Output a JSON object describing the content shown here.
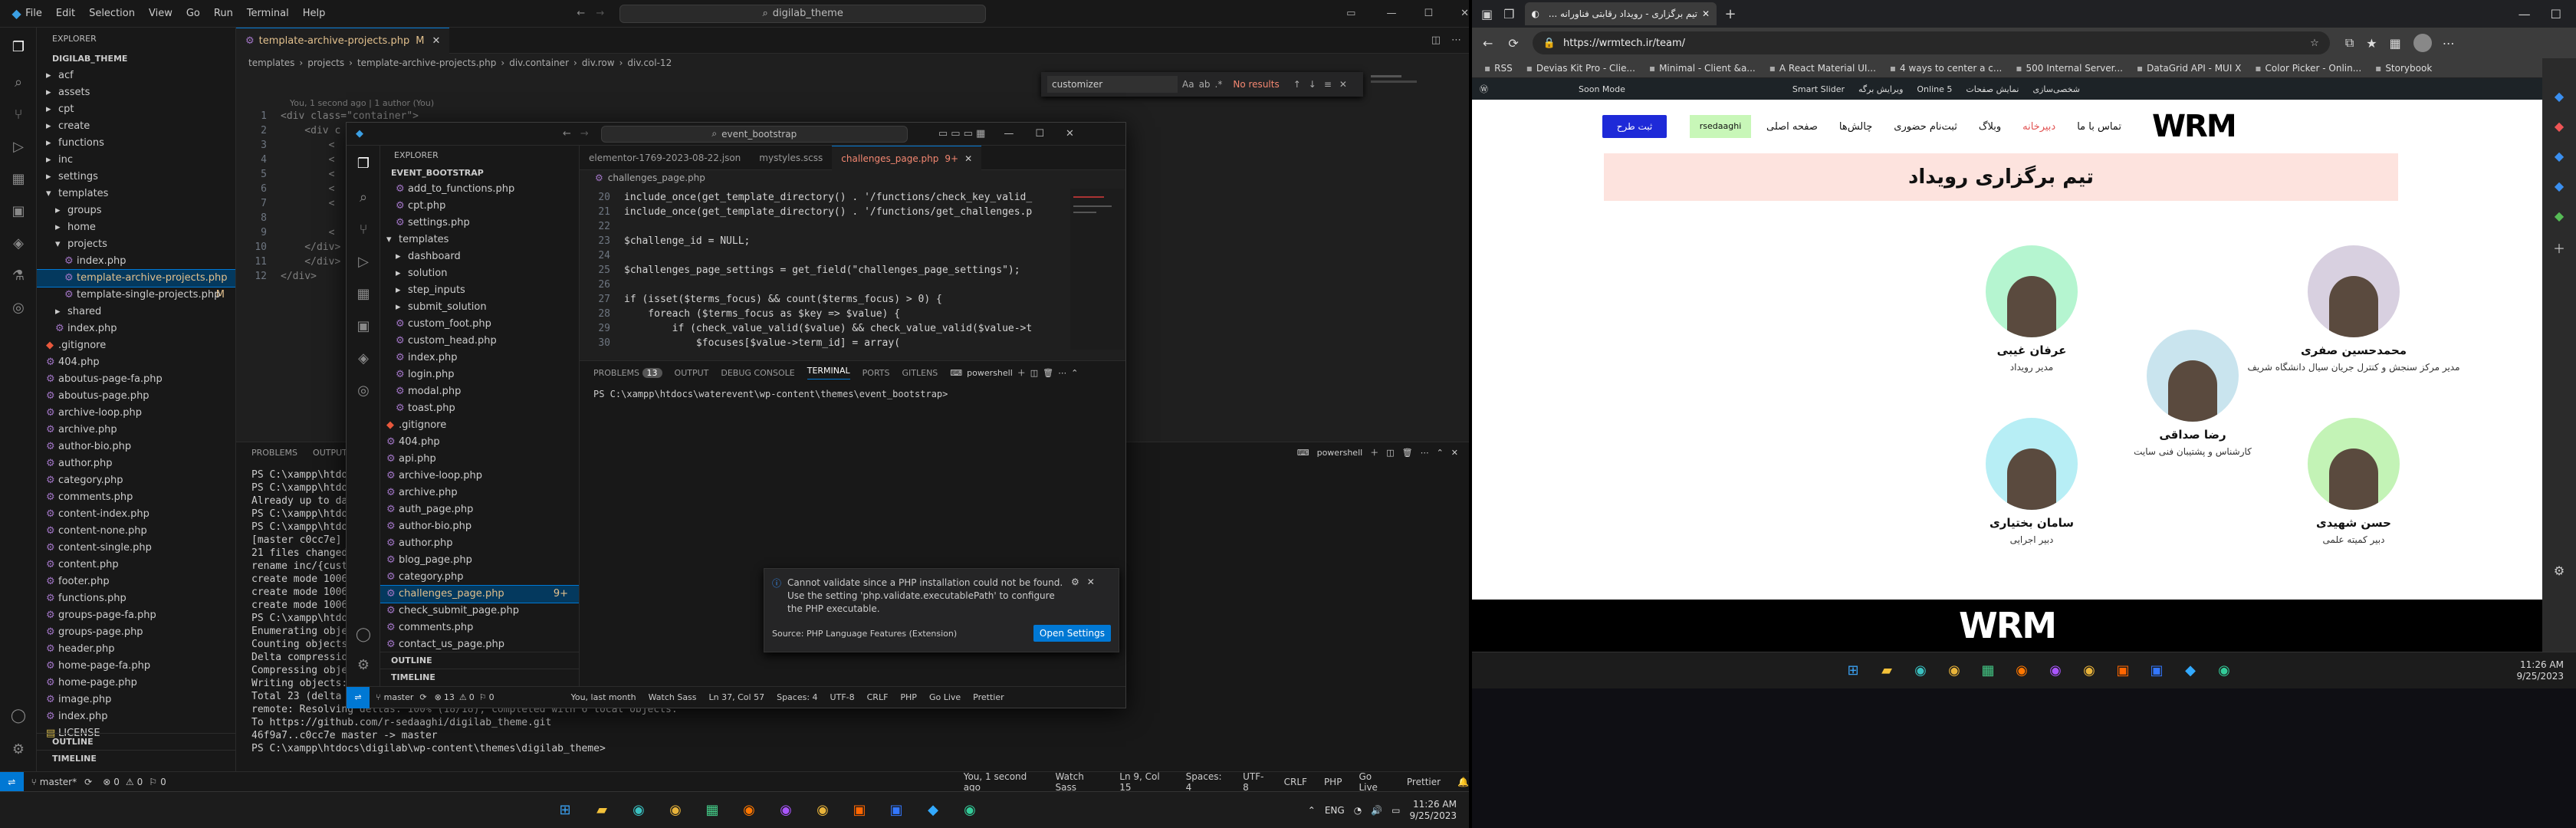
{
  "outer_vscode": {
    "menu": [
      "File",
      "Edit",
      "Selection",
      "View",
      "Go",
      "Run",
      "Terminal",
      "Help"
    ],
    "search": "digilab_theme",
    "explorer_title": "EXPLORER",
    "root": "DIGILAB_THEME",
    "tree": [
      {
        "t": "acf",
        "k": "f",
        "d": 1
      },
      {
        "t": "assets",
        "k": "f",
        "d": 1
      },
      {
        "t": "cpt",
        "k": "f",
        "d": 1
      },
      {
        "t": "create",
        "k": "f",
        "d": 1
      },
      {
        "t": "functions",
        "k": "f",
        "d": 1
      },
      {
        "t": "inc",
        "k": "f",
        "d": 1
      },
      {
        "t": "settings",
        "k": "f",
        "d": 1
      },
      {
        "t": "templates",
        "k": "fo",
        "d": 1
      },
      {
        "t": "groups",
        "k": "f",
        "d": 2
      },
      {
        "t": "home",
        "k": "f",
        "d": 2
      },
      {
        "t": "projects",
        "k": "fo",
        "d": 2
      },
      {
        "t": "index.php",
        "k": "p",
        "d": 3
      },
      {
        "t": "template-archive-projects.php",
        "k": "p",
        "d": 3,
        "sel": true,
        "m": "M"
      },
      {
        "t": "template-single-projects.php",
        "k": "p",
        "d": 3
      },
      {
        "t": "shared",
        "k": "f",
        "d": 2
      },
      {
        "t": "index.php",
        "k": "p",
        "d": 2
      },
      {
        "t": ".gitignore",
        "k": "g",
        "d": 1
      },
      {
        "t": "404.php",
        "k": "p",
        "d": 1
      },
      {
        "t": "aboutus-page-fa.php",
        "k": "p",
        "d": 1
      },
      {
        "t": "aboutus-page.php",
        "k": "p",
        "d": 1
      },
      {
        "t": "archive-loop.php",
        "k": "p",
        "d": 1
      },
      {
        "t": "archive.php",
        "k": "p",
        "d": 1
      },
      {
        "t": "author-bio.php",
        "k": "p",
        "d": 1
      },
      {
        "t": "author.php",
        "k": "p",
        "d": 1
      },
      {
        "t": "category.php",
        "k": "p",
        "d": 1
      },
      {
        "t": "comments.php",
        "k": "p",
        "d": 1
      },
      {
        "t": "content-index.php",
        "k": "p",
        "d": 1
      },
      {
        "t": "content-none.php",
        "k": "p",
        "d": 1
      },
      {
        "t": "content-single.php",
        "k": "p",
        "d": 1
      },
      {
        "t": "content.php",
        "k": "p",
        "d": 1
      },
      {
        "t": "footer.php",
        "k": "p",
        "d": 1
      },
      {
        "t": "functions.php",
        "k": "p",
        "d": 1
      },
      {
        "t": "groups-page-fa.php",
        "k": "p",
        "d": 1
      },
      {
        "t": "groups-page.php",
        "k": "p",
        "d": 1
      },
      {
        "t": "header.php",
        "k": "p",
        "d": 1
      },
      {
        "t": "home-page-fa.php",
        "k": "p",
        "d": 1
      },
      {
        "t": "home-page.php",
        "k": "p",
        "d": 1
      },
      {
        "t": "image.php",
        "k": "p",
        "d": 1
      },
      {
        "t": "index.php",
        "k": "p",
        "d": 1
      },
      {
        "t": "LICENSE",
        "k": "l",
        "d": 1
      }
    ],
    "outline": "OUTLINE",
    "timeline": "TIMELINE",
    "tab": "template-archive-projects.php",
    "tab_mod": "M",
    "breadcrumb": [
      "templates",
      "projects",
      "template-archive-projects.php",
      "div.container",
      "div.row",
      "div.col-12"
    ],
    "blame": "You, 1 second ago | 1 author (You)",
    "code": [
      {
        "n": "1",
        "t": "<div class=\"container\">"
      },
      {
        "n": "2",
        "t": "    <div c"
      },
      {
        "n": "3",
        "t": "        <"
      },
      {
        "n": "4",
        "t": "        <"
      },
      {
        "n": "5",
        "t": "        <"
      },
      {
        "n": "6",
        "t": "        <"
      },
      {
        "n": "7",
        "t": "        <"
      },
      {
        "n": "8",
        "t": ""
      },
      {
        "n": "9",
        "t": "        <"
      },
      {
        "n": "10",
        "t": "    </div>"
      },
      {
        "n": "11",
        "t": "    </div>"
      },
      {
        "n": "12",
        "t": "</div>"
      }
    ],
    "find": {
      "value": "customizer",
      "result": "No results"
    },
    "panel_tabs": [
      "PROBLEMS",
      "OUTPUT"
    ],
    "terminal_name": "powershell",
    "terminal": [
      "PS C:\\xampp\\htdoc",
      "PS C:\\xampp\\htdoc",
      "Already up to dat",
      "PS C:\\xampp\\htdoc",
      "PS C:\\xampp\\htdoc",
      "[master c0cc7e]",
      "  21 files changed",
      "  rename inc/{cust",
      "  create mode 1006",
      "  create mode 1006",
      "  create mode 1006",
      "PS C:\\xampp\\htdoc",
      "Enumerating objec",
      "Counting objects:",
      "Delta compression",
      "Compressing objec",
      "Writing objects: 100% (...)",
      "Total 23 (delta 18), reused 0 (delta 0), pack-reused 0",
      "remote: Resolving deltas: 100% (18/18), completed with 6 local objects.",
      "To https://github.com/r-sedaaghi/digilab_theme.git",
      "   46f9a7..c0cc7e  master -> master",
      "PS C:\\xampp\\htdocs\\digilab\\wp-content\\themes\\digilab_theme> "
    ],
    "status": {
      "branch": "master*",
      "errors": "0",
      "warnings": "0",
      "ports": "0",
      "blame": "You, 1 second ago",
      "sass": "Watch Sass",
      "pos": "Ln 9, Col 15",
      "spaces": "Spaces: 4",
      "enc": "UTF-8",
      "eol": "CRLF",
      "lang": "PHP",
      "live": "Go Live",
      "prettier": "Prettier"
    }
  },
  "inner_vscode": {
    "search": "event_bootstrap",
    "explorer_title": "EXPLORER",
    "root": "EVENT_BOOTSTRAP",
    "tree": [
      {
        "t": "add_to_functions.php",
        "k": "p",
        "d": 1
      },
      {
        "t": "cpt.php",
        "k": "p",
        "d": 1
      },
      {
        "t": "settings.php",
        "k": "p",
        "d": 1
      },
      {
        "t": "templates",
        "k": "fo",
        "d": 0
      },
      {
        "t": "dashboard",
        "k": "f",
        "d": 1
      },
      {
        "t": "solution",
        "k": "f",
        "d": 1
      },
      {
        "t": "step_inputs",
        "k": "f",
        "d": 1
      },
      {
        "t": "submit_solution",
        "k": "f",
        "d": 1
      },
      {
        "t": "custom_foot.php",
        "k": "p",
        "d": 1
      },
      {
        "t": "custom_head.php",
        "k": "p",
        "d": 1
      },
      {
        "t": "index.php",
        "k": "p",
        "d": 1
      },
      {
        "t": "login.php",
        "k": "p",
        "d": 1
      },
      {
        "t": "modal.php",
        "k": "p",
        "d": 1
      },
      {
        "t": "toast.php",
        "k": "p",
        "d": 1
      },
      {
        "t": ".gitignore",
        "k": "g",
        "d": 0
      },
      {
        "t": "404.php",
        "k": "p",
        "d": 0
      },
      {
        "t": "api.php",
        "k": "p",
        "d": 0
      },
      {
        "t": "archive-loop.php",
        "k": "p",
        "d": 0
      },
      {
        "t": "archive.php",
        "k": "p",
        "d": 0
      },
      {
        "t": "auth_page.php",
        "k": "p",
        "d": 0
      },
      {
        "t": "author-bio.php",
        "k": "p",
        "d": 0
      },
      {
        "t": "author.php",
        "k": "p",
        "d": 0
      },
      {
        "t": "blog_page.php",
        "k": "p",
        "d": 0
      },
      {
        "t": "category.php",
        "k": "p",
        "d": 0
      },
      {
        "t": "challenges_page.php",
        "k": "p",
        "d": 0,
        "sel": true,
        "m": "9+"
      },
      {
        "t": "check_submit_page.php",
        "k": "p",
        "d": 0
      },
      {
        "t": "comments.php",
        "k": "p",
        "d": 0
      },
      {
        "t": "contact_us_page.php",
        "k": "p",
        "d": 0
      }
    ],
    "outline": "OUTLINE",
    "timeline": "TIMELINE",
    "tabs": [
      {
        "label": "elementor-1769-2023-08-22.json",
        "active": false
      },
      {
        "label": "mystyles.scss",
        "active": false
      },
      {
        "label": "challenges_page.php",
        "active": true,
        "badge": "9+"
      }
    ],
    "breadcrumb": "challenges_page.php",
    "code": [
      {
        "n": "20",
        "t": "include_once(get_template_directory() . '/functions/check_key_valid_"
      },
      {
        "n": "21",
        "t": "include_once(get_template_directory() . '/functions/get_challenges.p"
      },
      {
        "n": "22",
        "t": ""
      },
      {
        "n": "23",
        "t": "$challenge_id = NULL;"
      },
      {
        "n": "24",
        "t": ""
      },
      {
        "n": "25",
        "t": "$challenges_page_settings = get_field(\"challenges_page_settings\");"
      },
      {
        "n": "26",
        "t": ""
      },
      {
        "n": "27",
        "t": "if (isset($terms_focus) && count($terms_focus) > 0) {"
      },
      {
        "n": "28",
        "t": "    foreach ($terms_focus as $key => $value) {"
      },
      {
        "n": "29",
        "t": "        if (check_value_valid($value) && check_value_valid($value->t"
      },
      {
        "n": "30",
        "t": "            $focuses[$value->term_id] = array("
      }
    ],
    "panel_tabs": [
      "PROBLEMS",
      "OUTPUT",
      "DEBUG CONSOLE",
      "TERMINAL",
      "PORTS",
      "GITLENS"
    ],
    "problems_count": "13",
    "terminal_name": "powershell",
    "prompt": "PS C:\\xampp\\htdocs\\waterevent\\wp-content\\themes\\event_bootstrap>",
    "notification": {
      "text": "Cannot validate since a PHP installation could not be found. Use the setting 'php.validate.executablePath' to configure the PHP executable.",
      "source": "Source: PHP Language Features (Extension)",
      "button": "Open Settings"
    },
    "status": {
      "branch": "master",
      "errors": "13",
      "warnings": "0",
      "ports": "0",
      "blame": "You, last month",
      "sass": "Watch Sass",
      "pos": "Ln 37, Col 57",
      "spaces": "Spaces: 4",
      "enc": "UTF-8",
      "eol": "CRLF",
      "lang": "PHP",
      "live": "Go Live",
      "prettier": "Prettier"
    }
  },
  "browser": {
    "tab_title": "تیم برگزاری - رویداد رقابتی فناورانه ...",
    "url": "https://wrmtech.ir/team/",
    "bookmarks": [
      "RSS",
      "Devias Kit Pro - Clie...",
      "Minimal - Client &a...",
      "A React Material UI...",
      "4 ways to center a c...",
      "500 Internal Server...",
      "DataGrid API - MUI X",
      "Color Picker - Onlin...",
      "Storybook"
    ],
    "wpbar": [
      "Soon Mode",
      "Smart Slider",
      "ویرایش برگه",
      "Online 5",
      "شخصی‌سازی",
      "نمایش صفحات"
    ],
    "site_nav": [
      "صفحه اصلی",
      "چالش‌ها",
      "ثبت‌نام حضوری",
      "وبلاگ",
      "دبیرخانه",
      "تماس با ما"
    ],
    "submit_btn": "ثبت طرح",
    "user": "rsedaaghi",
    "page_title": "تیم برگزاری رویداد",
    "people": [
      {
        "name": "محمدحسین صفری",
        "role": "مدیر مرکز سنجش و کنترل جریان سیال دانشگاه شریف",
        "bg": "#d8d0e0"
      },
      {
        "name": "عرفان غیبی",
        "role": "مدیر رویداد",
        "bg": "#b5f5d0"
      },
      {
        "name": "رضا صداقی",
        "role": "کارشناس و پشتیبان فنی سایت",
        "bg": "#c9e4ee"
      },
      {
        "name": "حسن شهیدی",
        "role": "دبیر کمیته علمی",
        "bg": "#c3f3b6"
      },
      {
        "name": "سامان بختیاری",
        "role": "دبیر اجرایی",
        "bg": "#b7eef5"
      }
    ],
    "logo": "WRM"
  },
  "taskbar": {
    "lang": "ENG",
    "time": "11:26 AM",
    "date": "9/25/2023"
  }
}
